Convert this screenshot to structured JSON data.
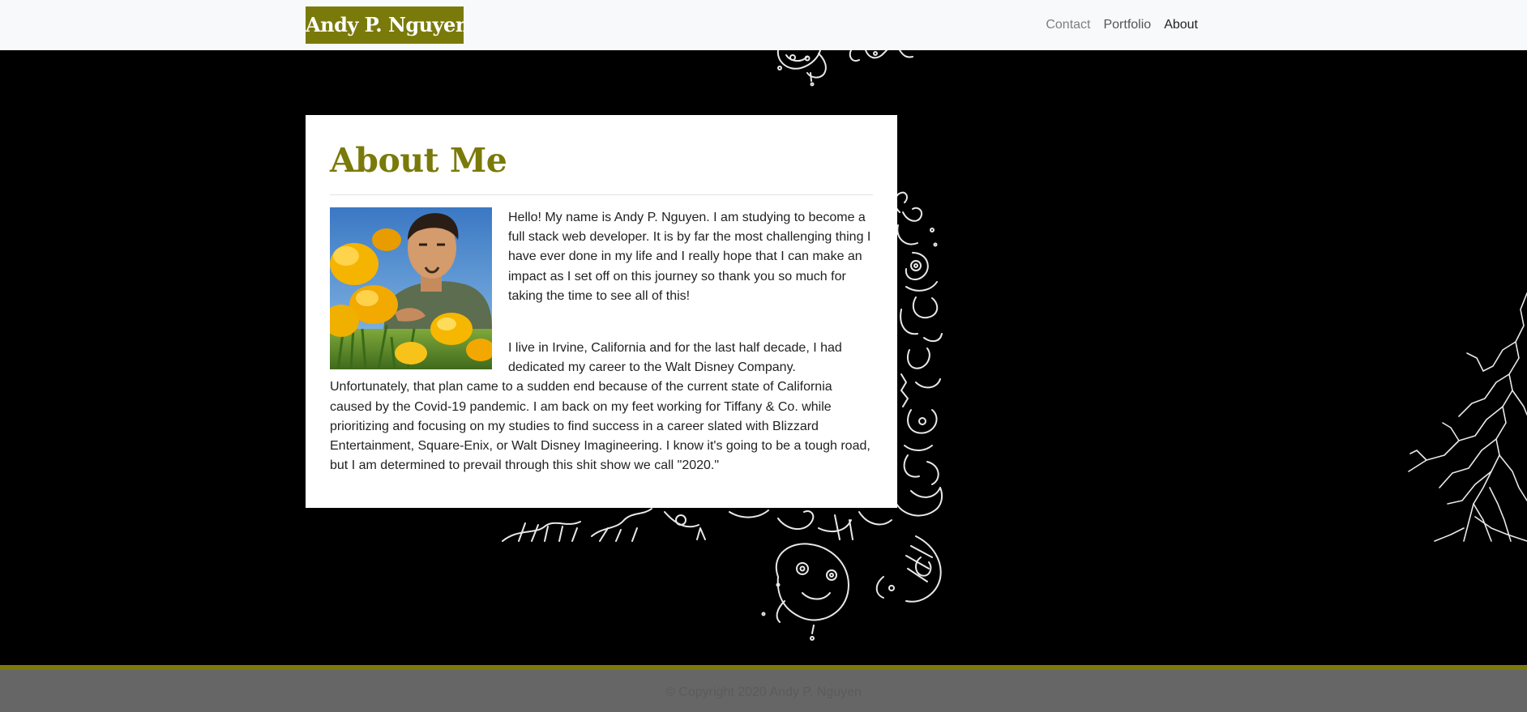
{
  "navbar": {
    "brand": "Andy P. Nguyen",
    "links": [
      {
        "label": "Contact"
      },
      {
        "label": "Portfolio"
      },
      {
        "label": "About"
      }
    ]
  },
  "about": {
    "title": "About Me",
    "photo_alt": "Andy P. Nguyen with yellow poppies",
    "paragraphs": [
      "Hello! My name is Andy P. Nguyen. I am studying to become a full stack web developer. It is by far the most challenging thing I have ever done in my life and I really hope that I can make an impact as I set off on this journey so thank you so much for taking the time to see all of this!",
      "I live in Irvine, California and for the last half decade, I had dedicated my career to the Walt Disney Company. Unfortunately, that plan came to a sudden end because of the current state of California caused by the Covid-19 pandemic. I am back on my feet working for Tiffany & Co. while prioritizing and focusing on my studies to find success in a career slated with Blizzard Entertainment, Square-Enix, or Walt Disney Imagineering. I know it's going to be a tough road, but I am determined to prevail through this shit show we call \"2020.\""
    ]
  },
  "footer": {
    "copyright": "© Copyright 2020 Andy P. Nguyen"
  },
  "colors": {
    "accent": "#7a7a0a",
    "navbar_bg": "#f8f9fa",
    "footer_bg": "#666666",
    "page_bg": "#000000"
  }
}
